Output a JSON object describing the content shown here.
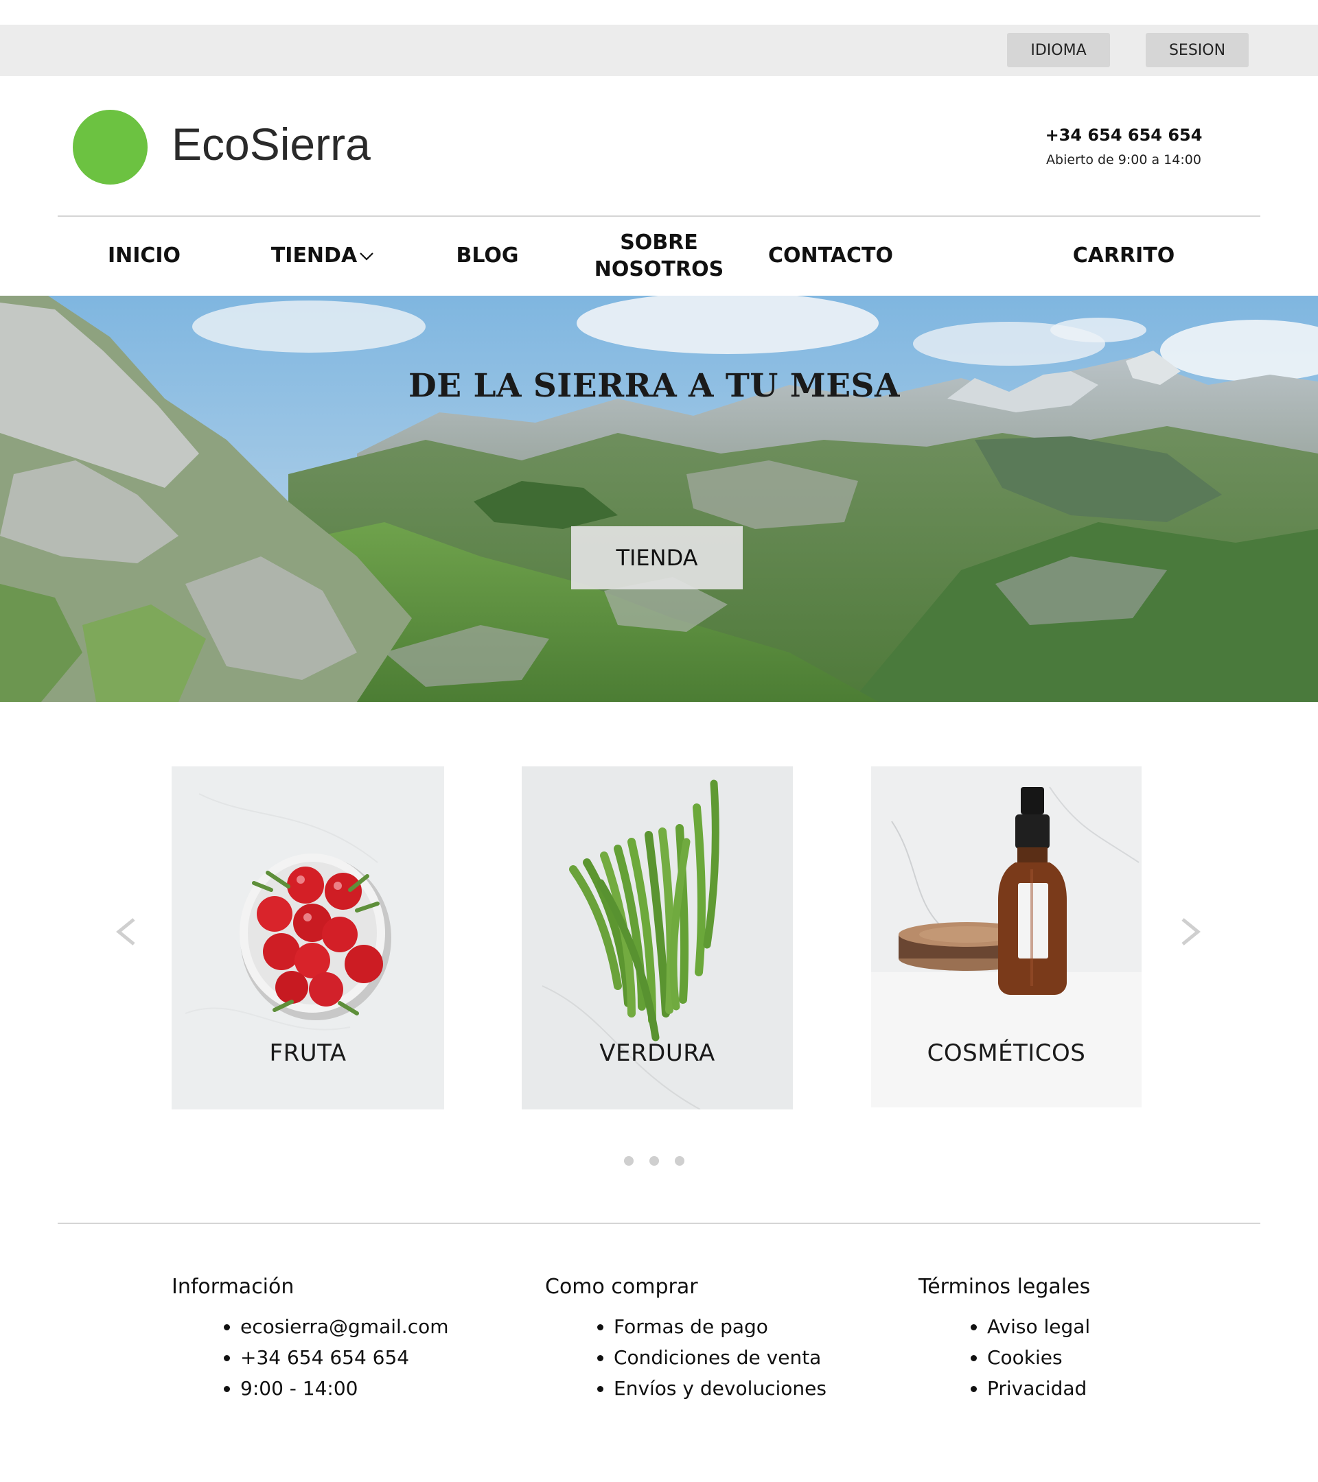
{
  "topbar": {
    "language_label": "IDIOMA",
    "session_label": "SESION"
  },
  "header": {
    "brand": "EcoSierra",
    "phone": "+34 654 654 654",
    "hours": "Abierto de 9:00 a 14:00",
    "logo_color": "#6cc241"
  },
  "nav": {
    "inicio": "INICIO",
    "tienda": "TIENDA",
    "blog": "BLOG",
    "sobre_line1": "SOBRE",
    "sobre_line2": "NOSOTROS",
    "contacto": "CONTACTO",
    "carrito": "CARRITO",
    "dropdown_icon": "chevron-down-icon"
  },
  "hero": {
    "title": "DE LA SIERRA A TU MESA",
    "button": "TIENDA"
  },
  "categories": [
    {
      "label": "FRUTA"
    },
    {
      "label": "VERDURA"
    },
    {
      "label": "COSMÉTICOS"
    }
  ],
  "carousel": {
    "prev_icon": "chevron-left-icon",
    "next_icon": "chevron-right-icon",
    "dots": 3
  },
  "footer": {
    "info": {
      "title": "Información",
      "items": [
        "ecosierra@gmail.com",
        "+34 654 654 654",
        "9:00 - 14:00"
      ]
    },
    "how": {
      "title": "Como comprar",
      "items": [
        "Formas de pago",
        "Condiciones de venta",
        "Envíos y devoluciones"
      ]
    },
    "legal": {
      "title": "Términos legales",
      "items": [
        "Aviso legal",
        "Cookies",
        "Privacidad"
      ]
    }
  }
}
